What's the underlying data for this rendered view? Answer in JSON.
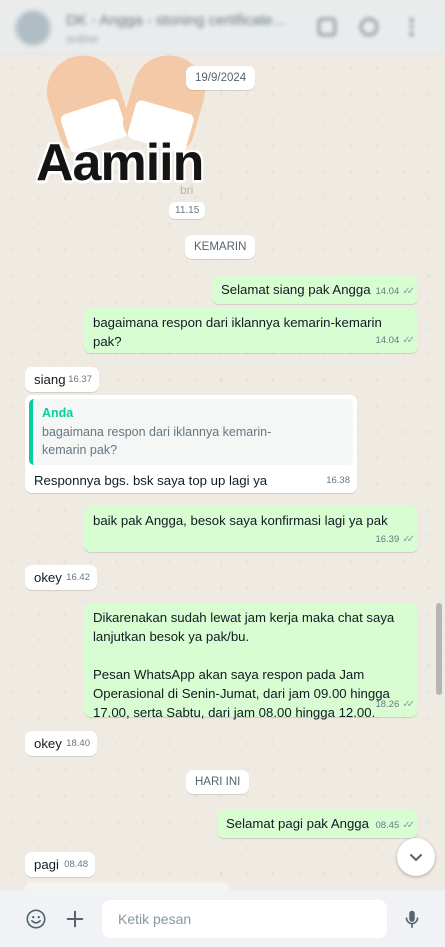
{
  "header": {
    "title": "DK - Angga - stoning certificate...",
    "status": "online"
  },
  "sticker": {
    "text": "Aamiin",
    "brand": "bri",
    "time": "11.15"
  },
  "dates": {
    "first": "19/9/2024",
    "yesterday": "KEMARIN",
    "today": "HARI INI"
  },
  "messages": [
    {
      "id": "m1",
      "text": "Selamat siang pak Angga",
      "time": "14.04"
    },
    {
      "id": "m2",
      "text": "bagaimana respon dari iklannya kemarin-kemarin pak?",
      "time": "14.04"
    },
    {
      "id": "m3",
      "text": "siang",
      "time": "16.37"
    },
    {
      "id": "m4",
      "quote_name": "Anda",
      "quote_text": "bagaimana respon dari iklannya kemarin-\nkemarin pak?",
      "text": "Responnya bgs. bsk saya top up lagi ya",
      "time": "16.38"
    },
    {
      "id": "m5",
      "text": "baik pak Angga, besok saya konfirmasi lagi ya pak",
      "time": "16.39"
    },
    {
      "id": "m6",
      "text": "okey",
      "time": "16.42"
    },
    {
      "id": "m7",
      "text": "Dikarenakan sudah lewat jam kerja maka chat saya\nlanjutkan besok ya pak/bu.\n\nPesan WhatsApp akan saya respon pada Jam\nOperasional di Senin-Jumat, dari jam 09.00 hingga\n17.00, serta Sabtu, dari jam 08.00 hingga 12.00.",
      "time": "18.26"
    },
    {
      "id": "m8",
      "text": "okey",
      "time": "18.40"
    },
    {
      "id": "m9",
      "text": "Selamat pagi pak Angga",
      "time": "08.45"
    },
    {
      "id": "m10",
      "text": "pagi",
      "time": "08.48"
    }
  ],
  "composer": {
    "placeholder": "Ketik pesan"
  },
  "icons": {
    "emoji": "emoji-icon",
    "attach": "plus-icon",
    "mic": "microphone-icon",
    "scroll": "chevron-down-icon",
    "read": "double-check-icon"
  },
  "colors": {
    "outgoing": "#d9fdd3",
    "incoming": "#ffffff",
    "accent": "#06cf9c"
  }
}
